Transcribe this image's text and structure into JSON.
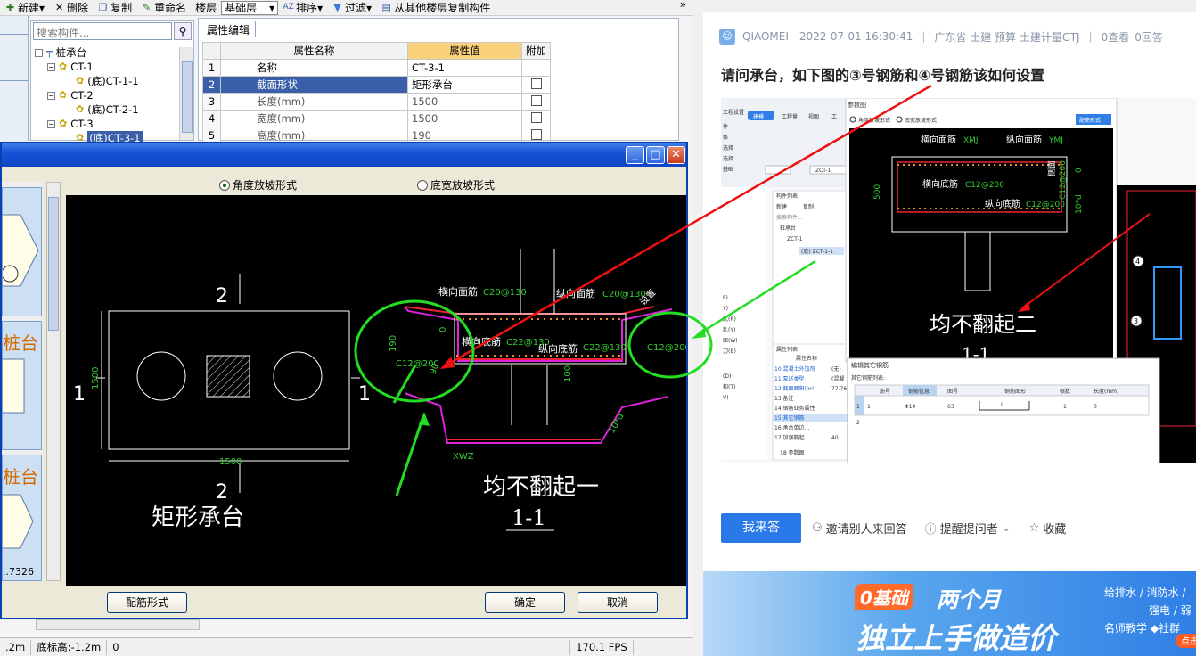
{
  "toolbar": {
    "new": "新建",
    "delete": "删除",
    "copy": "复制",
    "rename": "重命名",
    "floor_label": "楼层",
    "floor_value": "基础层",
    "sort": "排序",
    "filter": "过滤",
    "copy_from_floor": "从其他楼层复制构件",
    "more": "»"
  },
  "tree": {
    "search_placeholder": "搜索构件...",
    "root": "桩承台",
    "nodes": [
      {
        "label": "CT-1",
        "child": "(底)CT-1-1"
      },
      {
        "label": "CT-2",
        "child": "(底)CT-2-1"
      },
      {
        "label": "CT-3",
        "child": "(底)CT-3-1"
      }
    ]
  },
  "props": {
    "tab": "属性编辑",
    "headers": [
      "属性名称",
      "属性值",
      "附加"
    ],
    "rows": [
      {
        "num": "1",
        "name": "名称",
        "value": "CT-3-1",
        "check": false
      },
      {
        "num": "2",
        "name": "截面形状",
        "value": "矩形承台",
        "check": true
      },
      {
        "num": "3",
        "name": "长度(mm)",
        "value": "1500",
        "check": true
      },
      {
        "num": "4",
        "name": "宽度(mm)",
        "value": "1500",
        "check": true
      },
      {
        "num": "5",
        "name": "高度(mm)",
        "value": "190",
        "check": true
      }
    ]
  },
  "dialog": {
    "radio1": "角度放坡形式",
    "radio2": "底宽放坡形式",
    "strip_label_1": "桩台",
    "strip_label_2": "桩台",
    "strip_value": "..7326",
    "btn_rebar": "配筋形式",
    "btn_ok": "确定",
    "btn_cancel": "取消"
  },
  "drawing": {
    "plan_title": "矩形承台",
    "section_title": "均不翻起一",
    "section_label": "1-1",
    "cut_2": "2",
    "cut_1": "1",
    "dim_1500": "1500",
    "top_transverse": "横向面筋",
    "top_transverse_val": "C20@130",
    "top_long": "纵向面筋",
    "top_long_val": "C20@130",
    "bot_transverse": "横向底筋",
    "bot_transverse_val": "C22@130",
    "bot_long": "纵向底筋",
    "bot_long_val": "C22@130",
    "side_bar": "C12@200",
    "side_bar2": "C12@200",
    "dim_190": "190",
    "dim_0": "0",
    "dim_100": "100",
    "dim_90": "90",
    "dim_10d": "10*d",
    "xwz": "XWZ",
    "note": "设置"
  },
  "status": {
    "cell1": ".2m",
    "cell2": "底标高:-1.2m",
    "cell3": "0",
    "fps": "170.1 FPS"
  },
  "web": {
    "user": "QIAOMEI",
    "datetime": "2022-07-01 16:30:41",
    "region": "广东省 土建 预算 土建计量GTJ",
    "views": "0查看",
    "answers": "0回答",
    "title": "请问承台，如下图的③号钢筋和④号钢筋该如何设置",
    "answer_btn": "我来答",
    "invite": "邀请别人来回答",
    "remind": "提醒提问者",
    "collect": "收藏"
  },
  "shot": {
    "ref_title": "参数图",
    "radio1": "角度放坡形式",
    "radio2": "底宽放坡形式",
    "btn": "配筋形式",
    "top_t": "横向面筋",
    "top_t_val": "XMJ",
    "top_l": "纵向面筋",
    "top_l_val": "YMJ",
    "bot_t": "横向底筋",
    "bot_t_val": "C12@200",
    "bot_l": "纵向底筋",
    "bot_l_val": "C12@200",
    "side": "侧面",
    "side_val": "C12@200",
    "dim_500": "500",
    "dim_0": "0",
    "dim_10d": "10*d",
    "big_text": "均不翻起二",
    "big_label": "1-1",
    "menu_items": [
      "工程设置",
      "建模",
      "工程量",
      "视图",
      "工"
    ],
    "tree_title": "构件列表",
    "tree_new": "新建",
    "tree_copy": "复制",
    "tree_root": "桩承台",
    "tree_zct": "ZCT-1",
    "tree_child": "(底) ZCT-1-1",
    "tree_search": "搜索构件...",
    "sel_value": "ZCT-1",
    "prop_title": "属性列表",
    "prop_col": "属性名称",
    "prop_rows": [
      "10 混凝土外加剂",
      "11 泵送类型",
      "12 截面面积(m²)",
      "13 备注",
      "14 钢筋业务属性",
      "15 其它钢筋",
      "16 承台单边...",
      "17 加强筋起...",
      "18 参数图"
    ],
    "prop_vals": [
      "(无)",
      "(混凝",
      "77.76",
      "",
      "",
      "",
      "",
      "40",
      ""
    ],
    "edit_title": "编辑其它钢筋",
    "edit_list": "其它钢筋列表:",
    "edit_headers": [
      "筋号",
      "钢筋信息",
      "图号",
      "钢筋图形",
      "根数",
      "长度(mm)"
    ],
    "edit_row1": [
      "1",
      "1",
      "Φ14",
      "63",
      "L",
      "1",
      "0"
    ],
    "edit_row2": "2",
    "markers": [
      "4",
      "3"
    ],
    "left_labels": [
      "件",
      "择",
      "选择",
      "选择",
      "基础"
    ],
    "side_labels": [
      "F)",
      "Y)",
      "乱(R)",
      "乱(Y)",
      "面(W)",
      "刀(B)",
      "(D)",
      "和(T)",
      "V)"
    ]
  },
  "banner": {
    "tag": "0基础",
    "line1": "两个月",
    "line2": "独立上手做造价",
    "right1": "给排水 / 消防水 /",
    "right2": "强电 / 弱",
    "right3": "名师教学  ◆社群",
    "pill": "点击"
  }
}
